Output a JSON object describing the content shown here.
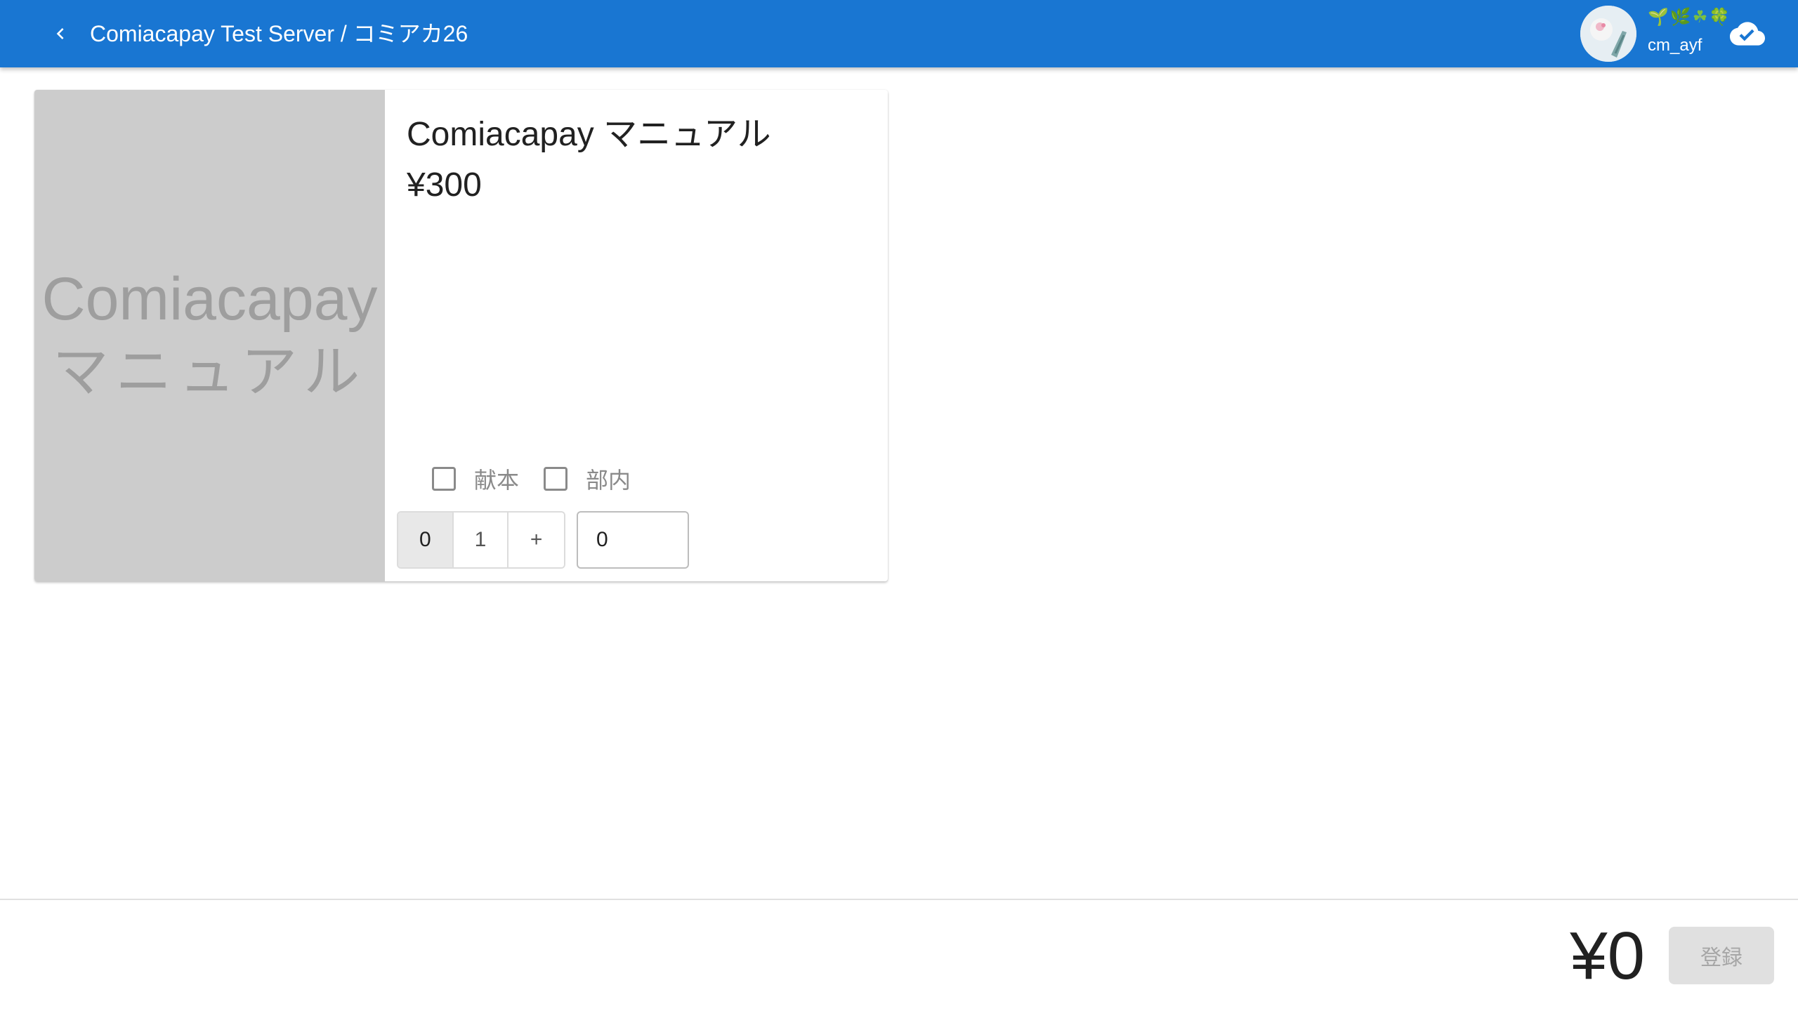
{
  "appbar": {
    "title": "Comiacapay Test Server / コミアカ26",
    "user_emoji": "🌱🌿☘🍀",
    "username": "cm_ayf",
    "back_icon": "chevron-left-icon",
    "sync_icon": "cloud-check-icon"
  },
  "item": {
    "image_line1": "Comiacapay",
    "image_line2": "マニュアル",
    "name": "Comiacapay マニュアル",
    "price": "¥300",
    "options": [
      {
        "label": "献本",
        "checked": false
      },
      {
        "label": "部内",
        "checked": false
      }
    ],
    "quantity_buttons": [
      "0",
      "1",
      "+"
    ],
    "selected_quantity": "0",
    "quantity_value": "0"
  },
  "footer": {
    "total": "¥0",
    "submit_label": "登録",
    "submit_disabled": true
  },
  "colors": {
    "appbar": "#1976d2",
    "image_placeholder": "#cccccc",
    "disabled_button": "#e0e0e0"
  }
}
